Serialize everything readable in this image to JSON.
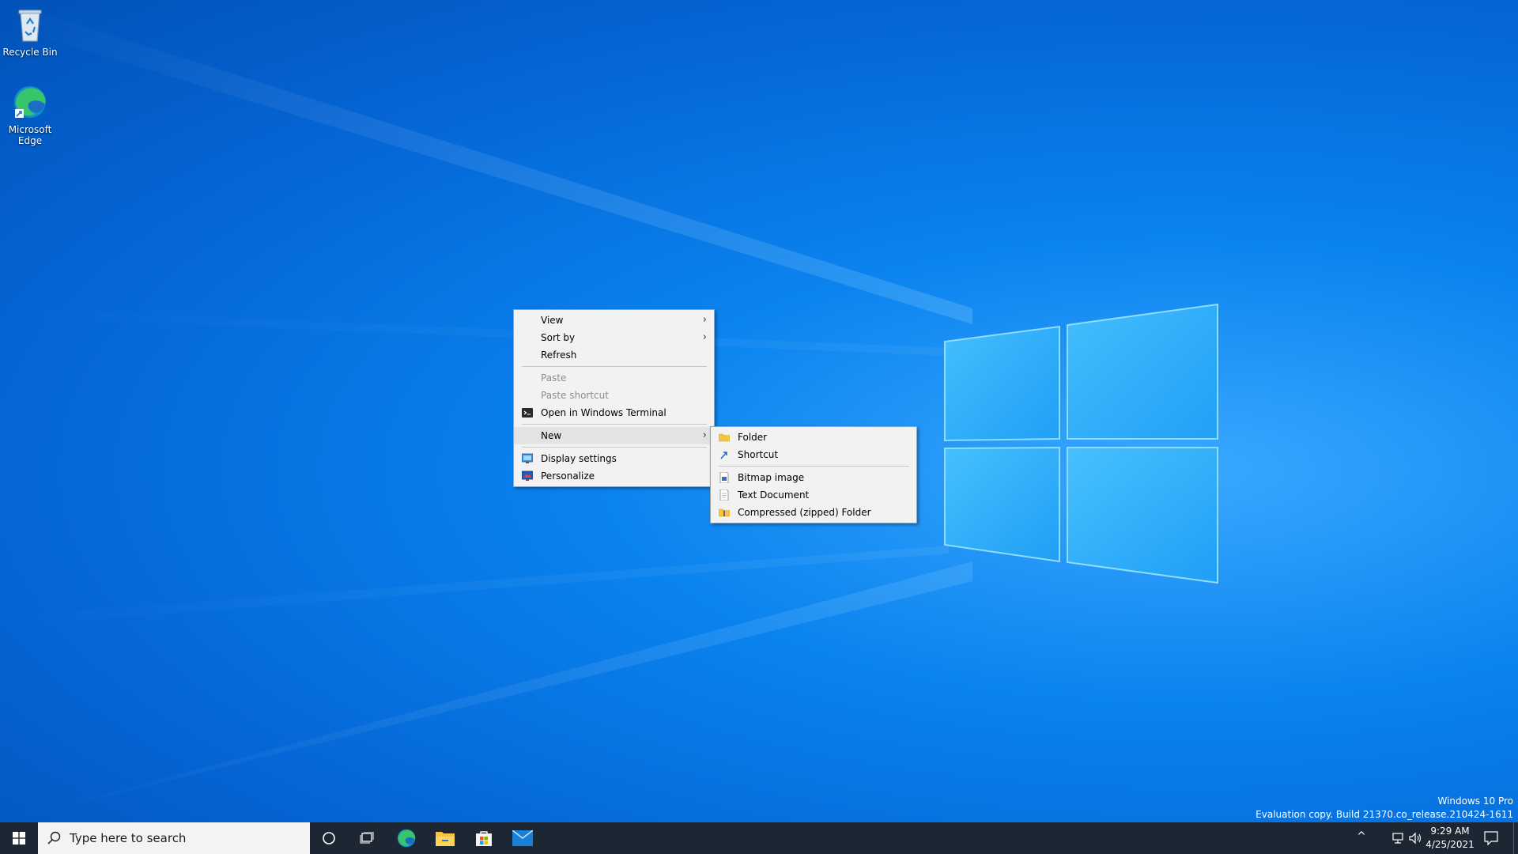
{
  "desktop": {
    "icons": [
      {
        "label": "Recycle Bin",
        "icon": "recycle-bin-icon"
      },
      {
        "label": "Microsoft Edge",
        "icon": "edge-icon"
      }
    ],
    "watermark": {
      "line1": "Windows 10 Pro",
      "line2": "Evaluation copy. Build 21370.co_release.210424-1611"
    }
  },
  "context_menu": {
    "items": [
      {
        "label": "View",
        "submenu": true
      },
      {
        "label": "Sort by",
        "submenu": true
      },
      {
        "label": "Refresh"
      },
      {
        "label": "Paste",
        "disabled": true
      },
      {
        "label": "Paste shortcut",
        "disabled": true
      },
      {
        "label": "Open in Windows Terminal",
        "icon": "terminal-icon"
      },
      {
        "label": "New",
        "submenu": true,
        "highlighted": true
      },
      {
        "label": "Display settings",
        "icon": "display-icon"
      },
      {
        "label": "Personalize",
        "icon": "personalize-icon"
      }
    ]
  },
  "new_submenu": {
    "items": [
      {
        "label": "Folder",
        "icon": "folder-icon"
      },
      {
        "label": "Shortcut",
        "icon": "shortcut-icon"
      },
      {
        "label": "Bitmap image",
        "icon": "bitmap-icon"
      },
      {
        "label": "Text Document",
        "icon": "text-document-icon"
      },
      {
        "label": "Compressed (zipped) Folder",
        "icon": "zip-folder-icon"
      }
    ]
  },
  "taskbar": {
    "search_placeholder": "Type here to search",
    "clock_time": "9:29 AM",
    "clock_date": "4/25/2021",
    "apps": [
      "cortana-icon",
      "task-view-icon",
      "edge-icon",
      "file-explorer-icon",
      "store-icon",
      "mail-icon"
    ]
  },
  "colors": {
    "desktop_blue": "#0a83ef",
    "taskbar": "#1d2633",
    "menu_bg": "#f2f2f2",
    "menu_highlight": "#e3e3e3"
  }
}
